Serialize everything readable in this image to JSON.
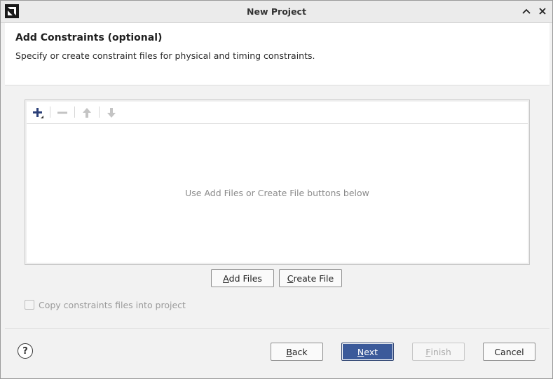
{
  "window": {
    "title": "New Project"
  },
  "header": {
    "title": "Add Constraints (optional)",
    "description": "Specify or create constraint files for physical and timing constraints."
  },
  "toolbar": {
    "icons": [
      "plus-icon",
      "minus-icon",
      "arrow-up-icon",
      "arrow-down-icon"
    ]
  },
  "file_list": {
    "empty_hint": "Use Add Files or Create File buttons below"
  },
  "buttons": {
    "add_files": {
      "mnemonic": "A",
      "rest": "dd Files"
    },
    "create_file": {
      "mnemonic": "C",
      "rest": "reate File"
    },
    "back": {
      "mnemonic": "B",
      "rest": "ack"
    },
    "next": {
      "mnemonic": "N",
      "rest": "ext"
    },
    "finish": {
      "mnemonic": "F",
      "rest": "inish"
    },
    "cancel": {
      "label": "Cancel"
    }
  },
  "copy_option": {
    "label": "Copy constraints files into project",
    "checked": false,
    "enabled": false
  },
  "help": {
    "symbol": "?"
  },
  "colors": {
    "primary_button": "#3b5a9a",
    "add_icon": "#2b3f78"
  }
}
